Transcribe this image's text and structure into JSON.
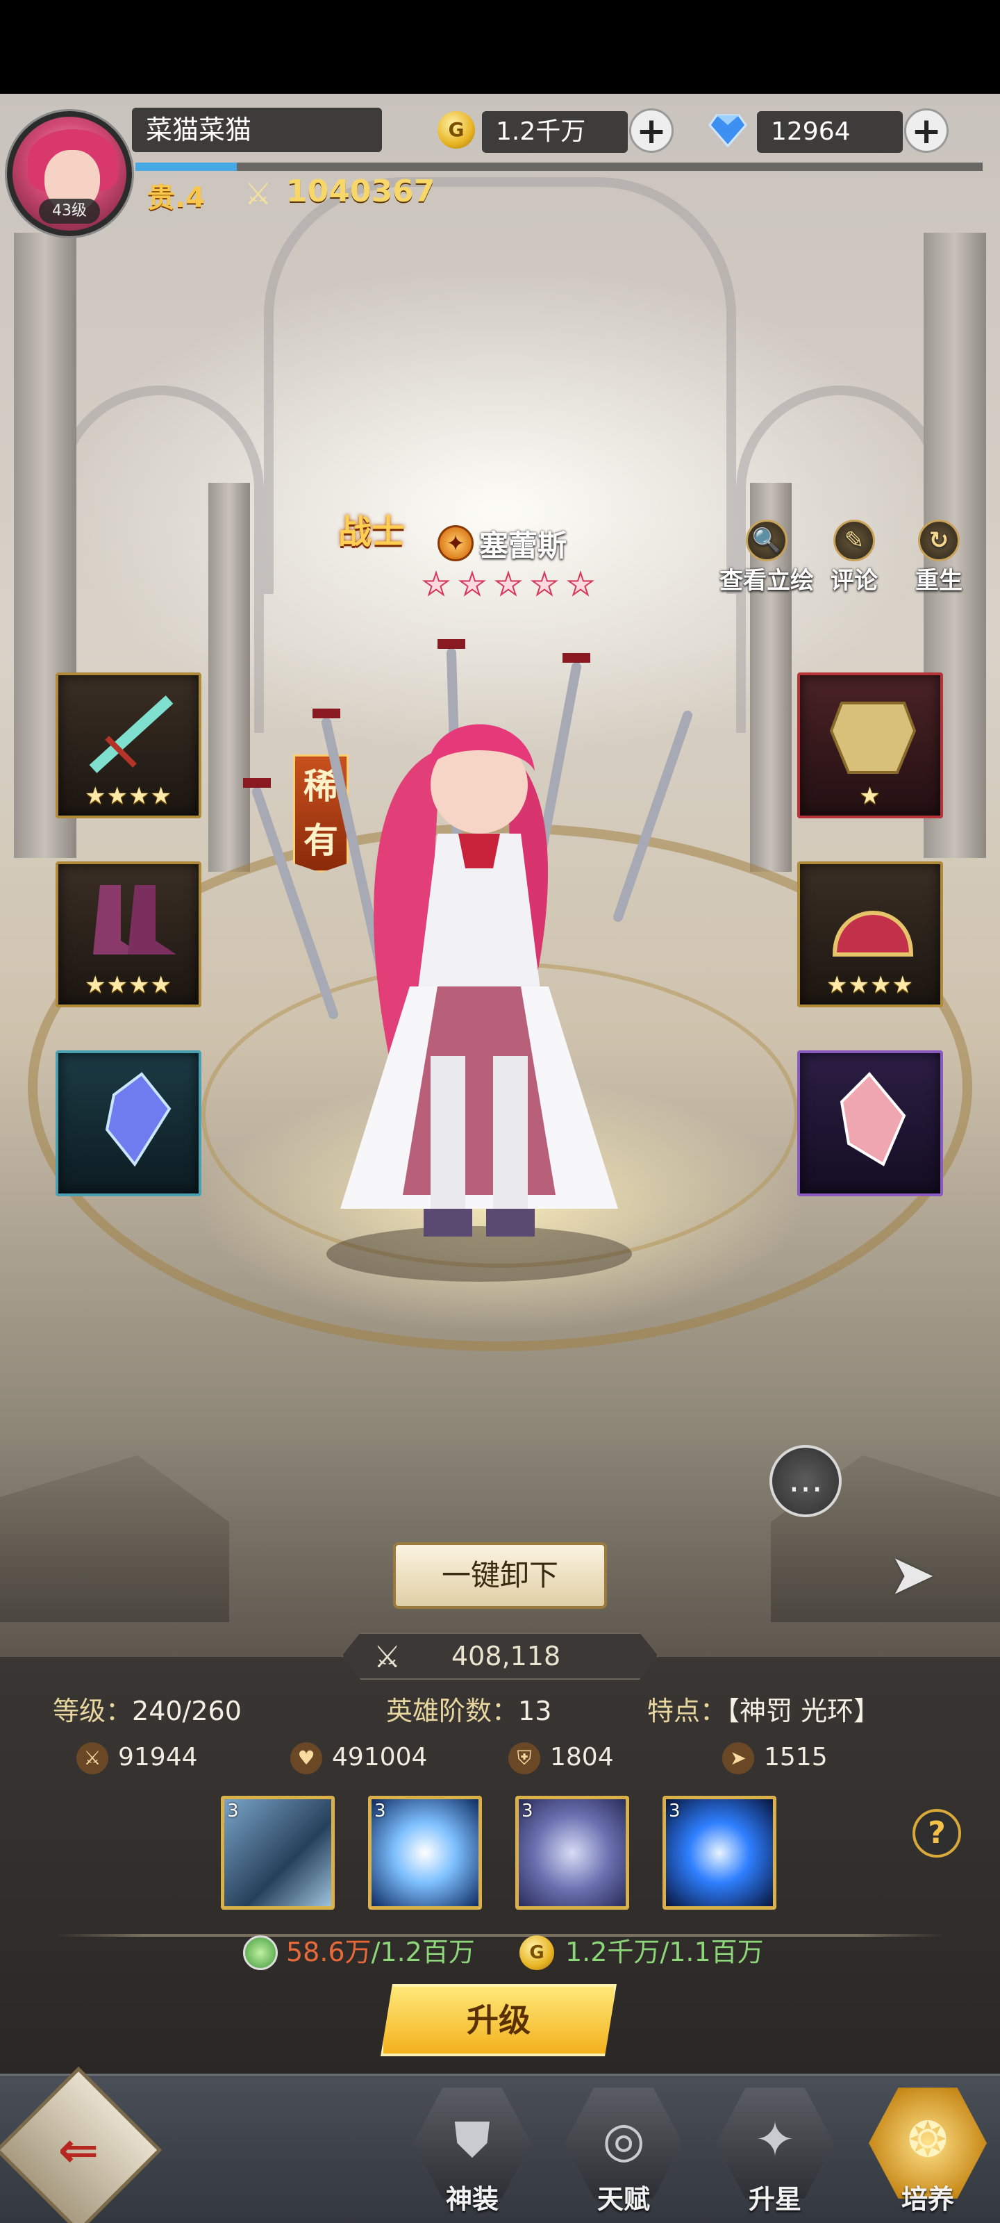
{
  "header": {
    "player_name": "菜猫菜猫",
    "avatar_level": "43级",
    "vip": "贵.4",
    "combat_power": "1040367",
    "exp_progress": 0.12,
    "gold": {
      "icon": "G",
      "value": "1.2千万",
      "plus": "+"
    },
    "diamond": {
      "value": "12964",
      "plus": "+"
    }
  },
  "hero": {
    "class_label": "战士",
    "name": "塞蕾斯",
    "stars": [
      "★",
      "★",
      "★",
      "★",
      "★"
    ],
    "rarity": "稀有",
    "faction_icon": "✦"
  },
  "top_actions": [
    {
      "label": "查看立绘",
      "icon": "🔍"
    },
    {
      "label": "评论",
      "icon": "✎"
    },
    {
      "label": "重生",
      "icon": "↻"
    }
  ],
  "equipment": {
    "weapon_stars": "★★★★",
    "armor_stars": "★",
    "boots_stars": "★★★★",
    "helmet_stars": "★★★★"
  },
  "unequip_all": "一键卸下",
  "panel": {
    "power_value": "408,118",
    "level_label": "等级：",
    "level_value": "240/260",
    "rank_label": "英雄阶数：",
    "rank_value": "13",
    "trait_label": "特点：",
    "trait_value": "【神罚 光环】",
    "stats": [
      {
        "icon": "⚔",
        "value": "91944"
      },
      {
        "icon": "♥",
        "value": "491004"
      },
      {
        "icon": "⛨",
        "value": "1804"
      },
      {
        "icon": "➤",
        "value": "1515"
      }
    ],
    "skills": [
      {
        "level": "3"
      },
      {
        "level": "3"
      },
      {
        "level": "3"
      },
      {
        "level": "3"
      }
    ],
    "help": "?",
    "cost_potion_current": "58.6万",
    "cost_potion_required": "/1.2百万",
    "cost_gold_icon": "G",
    "cost_gold_current": "1.2千万",
    "cost_gold_required": "/1.1百万",
    "upgrade_label": "升级"
  },
  "bottom_nav": [
    {
      "label": "神装",
      "icon": "⛊"
    },
    {
      "label": "天赋",
      "icon": "◎"
    },
    {
      "label": "升星",
      "icon": "✦"
    },
    {
      "label": "培养",
      "icon": "❂"
    }
  ]
}
